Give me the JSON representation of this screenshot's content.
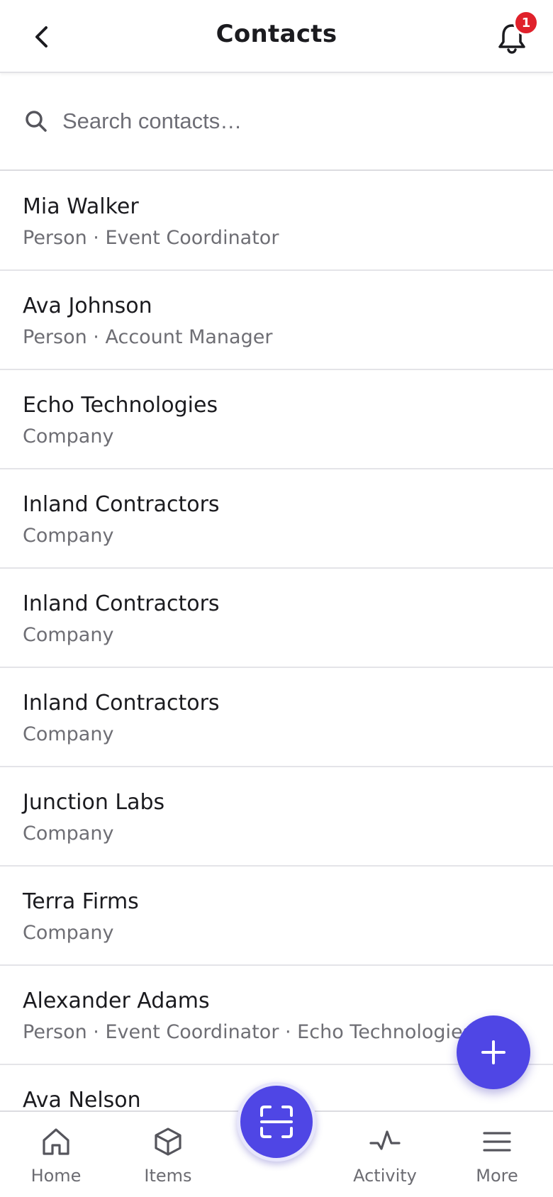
{
  "header": {
    "title": "Contacts",
    "notification_count": "1"
  },
  "search": {
    "placeholder": "Search contacts…"
  },
  "contacts": [
    {
      "name": "Mia Walker",
      "subtitle": "Person · Event Coordinator"
    },
    {
      "name": "Ava Johnson",
      "subtitle": "Person · Account Manager"
    },
    {
      "name": "Echo Technologies",
      "subtitle": "Company"
    },
    {
      "name": "Inland Contractors",
      "subtitle": "Company"
    },
    {
      "name": "Inland Contractors",
      "subtitle": "Company"
    },
    {
      "name": "Inland Contractors",
      "subtitle": "Company"
    },
    {
      "name": "Junction Labs",
      "subtitle": "Company"
    },
    {
      "name": "Terra Firms",
      "subtitle": "Company"
    },
    {
      "name": "Alexander Adams",
      "subtitle": "Person · Event Coordinator · Echo Technologies"
    },
    {
      "name": "Ava Nelson",
      "subtitle": ""
    }
  ],
  "nav": {
    "items": [
      {
        "label": "Home",
        "icon": "home-icon"
      },
      {
        "label": "Items",
        "icon": "box-icon"
      },
      {
        "label": "Activity",
        "icon": "activity-icon"
      },
      {
        "label": "More",
        "icon": "menu-icon"
      }
    ]
  },
  "colors": {
    "accent": "#4f46e5",
    "badge": "#e0212b"
  }
}
